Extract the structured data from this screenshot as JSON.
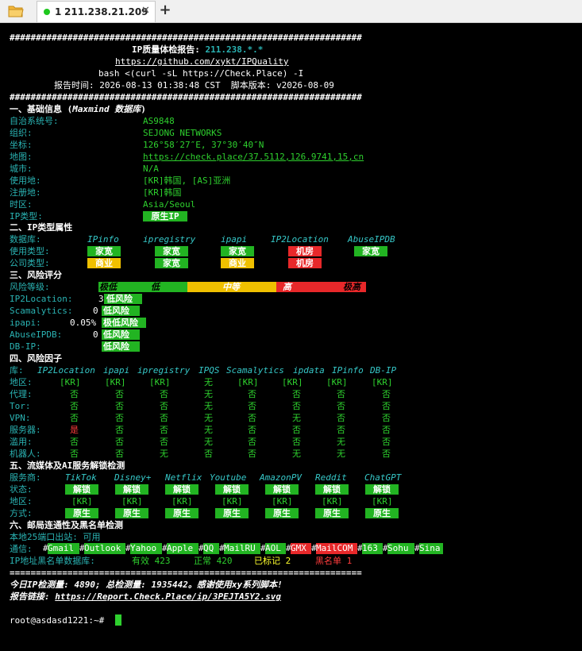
{
  "tabbar": {
    "tab_number": "1",
    "tab_title": "211.238.21.209",
    "close_label": "✕",
    "new_tab_label": "+"
  },
  "header": {
    "hash_line": "###################################################################",
    "title_prefix": "IP质量体检报告: ",
    "title_ip": "211.238.*.*",
    "repo_url": "https://github.com/xykt/IPQuality",
    "command": "bash <(curl -sL https://Check.Place) -I",
    "report_time": "报告时间: 2026-08-13 01:38:48 CST  脚本版本: v2026-08-09"
  },
  "basic": {
    "heading": "一、基础信息 (",
    "heading_src": "Maxmind 数据库",
    "heading_end": ")",
    "rows": [
      {
        "label": "自治系统号:",
        "value": "AS9848"
      },
      {
        "label": "组织:",
        "value": "SEJONG NETWORKS"
      },
      {
        "label": "坐标:",
        "value": "126°58′27″E, 37°30′40″N"
      },
      {
        "label": "地图:",
        "value": "https://check.place/37.5112,126.9741,15,cn"
      },
      {
        "label": "城市:",
        "value": "N/A"
      },
      {
        "label": "使用地:",
        "value": "[KR]韩国, [AS]亚洲"
      },
      {
        "label": "注册地:",
        "value": "[KR]韩国"
      },
      {
        "label": "时区:",
        "value": "Asia/Seoul"
      },
      {
        "label": "IP类型:",
        "value": "原生IP"
      }
    ]
  },
  "iptype": {
    "heading": "二、IP类型属性",
    "db_label": "数据库:",
    "dbs": [
      "IPinfo",
      "ipregistry",
      "ipapi",
      "IP2Location",
      "AbuseIPDB"
    ],
    "usage_label": "使用类型:",
    "usage": [
      "家宽",
      "家宽",
      "家宽",
      "机房",
      "家宽"
    ],
    "company_label": "公司类型:",
    "company": [
      "商业",
      "家宽",
      "商业",
      "机房"
    ]
  },
  "risk": {
    "heading": "三、风险评分",
    "level_label": "风险等级:",
    "levels": [
      "极低",
      "低",
      "中等",
      "高",
      "极高"
    ],
    "rows": [
      {
        "label": "IP2Location:",
        "value": "3",
        "desc": "低风险"
      },
      {
        "label": "Scamalytics:",
        "value": "0",
        "desc": "低风险"
      },
      {
        "label": "ipapi:",
        "value": "0.05%",
        "desc": "极低风险"
      },
      {
        "label": "AbuseIPDB:",
        "value": "0",
        "desc": "低风险"
      },
      {
        "label": "DB-IP:",
        "value": "",
        "desc": "低风险"
      }
    ]
  },
  "factors": {
    "heading": "四、风险因子",
    "lib_label": "库: ",
    "libs": [
      "IP2Location",
      "ipapi",
      "ipregistry",
      "IPQS",
      "Scamalytics",
      "ipdata",
      "IPinfo",
      "DB-IP"
    ],
    "rows": [
      {
        "label": "地区:",
        "values": [
          "[KR]",
          "[KR]",
          "[KR]",
          "无",
          "[KR]",
          "[KR]",
          "[KR]",
          "[KR]"
        ]
      },
      {
        "label": "代理:",
        "values": [
          "否",
          "否",
          "否",
          "无",
          "否",
          "否",
          "否",
          "否"
        ]
      },
      {
        "label": "Tor:",
        "values": [
          "否",
          "否",
          "否",
          "无",
          "否",
          "否",
          "否",
          "否"
        ]
      },
      {
        "label": "VPN:",
        "values": [
          "否",
          "否",
          "否",
          "无",
          "否",
          "无",
          "否",
          "否"
        ]
      },
      {
        "label": "服务器:",
        "values": [
          "是",
          "否",
          "否",
          "无",
          "否",
          "否",
          "否",
          "否"
        ]
      },
      {
        "label": "滥用:",
        "values": [
          "否",
          "否",
          "否",
          "无",
          "否",
          "否",
          "无",
          "否"
        ]
      },
      {
        "label": "机器人:",
        "values": [
          "否",
          "否",
          "无",
          "否",
          "否",
          "无",
          "无",
          "否"
        ]
      }
    ]
  },
  "media": {
    "heading": "五、流媒体及AI服务解锁检测",
    "svc_label": "服务商:",
    "services": [
      "TikTok",
      "Disney+",
      "Netflix",
      "Youtube",
      "AmazonPV",
      "Reddit",
      "ChatGPT"
    ],
    "status_label": "状态:",
    "status": [
      "解锁",
      "解锁",
      "解锁",
      "解锁",
      "解锁",
      "解锁",
      "解锁"
    ],
    "region_label": "地区:",
    "regions": [
      "[KR]",
      "[KR]",
      "[KR]",
      "[KR]",
      "[KR]",
      "[KR]",
      "[KR]"
    ],
    "method_label": "方式:",
    "methods": [
      "原生",
      "原生",
      "原生",
      "原生",
      "原生",
      "原生",
      "原生"
    ]
  },
  "mail": {
    "heading": "六、邮局连通性及黑名单检测",
    "port25": "本地25端口出站: 可用",
    "comm_label": "通信: ",
    "providers": [
      "Gmail",
      "Outlook",
      "Yahoo",
      "Apple",
      "QQ",
      "MailRU",
      "AOL",
      "GMX",
      "MailCOM",
      "163",
      "Sohu",
      "Sina"
    ],
    "blacklist_label": "IP地址黑名单数据库:",
    "valid": "有效 423",
    "normal": "正常 420",
    "marked": "已标记 2",
    "black": "黑名单 1"
  },
  "footer": {
    "eq_line": "===================================================================",
    "stats": "今日IP检测量: 4890; 总检测量: 1935442。感谢使用xy系列脚本!",
    "link_label": "报告链接: ",
    "link": "https://Report.Check.Place/ip/3PEJTA5Y2.svg",
    "prompt": "root@asdasd1221:~# "
  },
  "colors": {
    "terminal_bg": "#000000",
    "green": "#2ed02e",
    "red": "#e8282a",
    "yellow": "#f0c000",
    "cyan": "#2ab3b3"
  }
}
